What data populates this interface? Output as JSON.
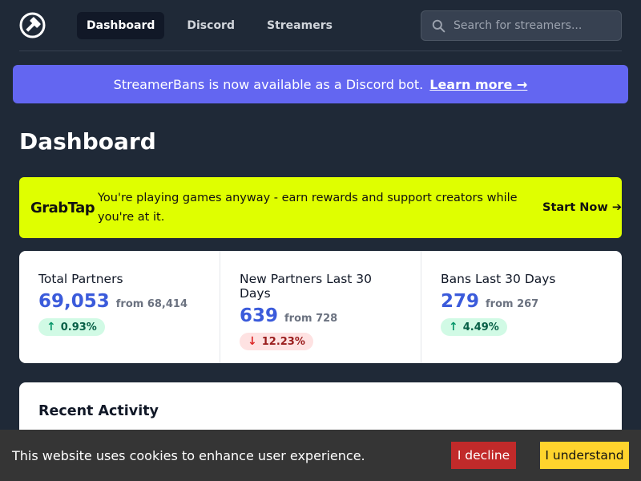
{
  "nav": {
    "logo_icon": "hammer-icon",
    "links": [
      {
        "label": "Dashboard",
        "active": true
      },
      {
        "label": "Discord",
        "active": false
      },
      {
        "label": "Streamers",
        "active": false
      }
    ],
    "search": {
      "placeholder": "Search for streamers...",
      "icon": "search-icon"
    }
  },
  "banner": {
    "text": "StreamerBans is now available as a Discord bot.",
    "link": "Learn more →",
    "color": "#6366f1"
  },
  "page": {
    "title": "Dashboard"
  },
  "ad": {
    "logo": "GrabTap",
    "text": "You're playing games anyway - earn rewards and support creators while you're at it.",
    "cta": "Start Now ➔",
    "color": "#dfff00"
  },
  "stats": [
    {
      "label": "Total Partners",
      "value": "69,053",
      "from": "from 68,414",
      "change": "0.93%",
      "direction": "up"
    },
    {
      "label": "New Partners Last 30 Days",
      "value": "639",
      "from": "from 728",
      "change": "12.23%",
      "direction": "down"
    },
    {
      "label": "Bans Last 30 Days",
      "value": "279",
      "from": "from 267",
      "change": "4.49%",
      "direction": "up"
    }
  ],
  "recent": {
    "title": "Recent Activity"
  },
  "cookie": {
    "text": "This website uses cookies to enhance user experience.",
    "decline": "I decline",
    "accept": "I understand"
  }
}
